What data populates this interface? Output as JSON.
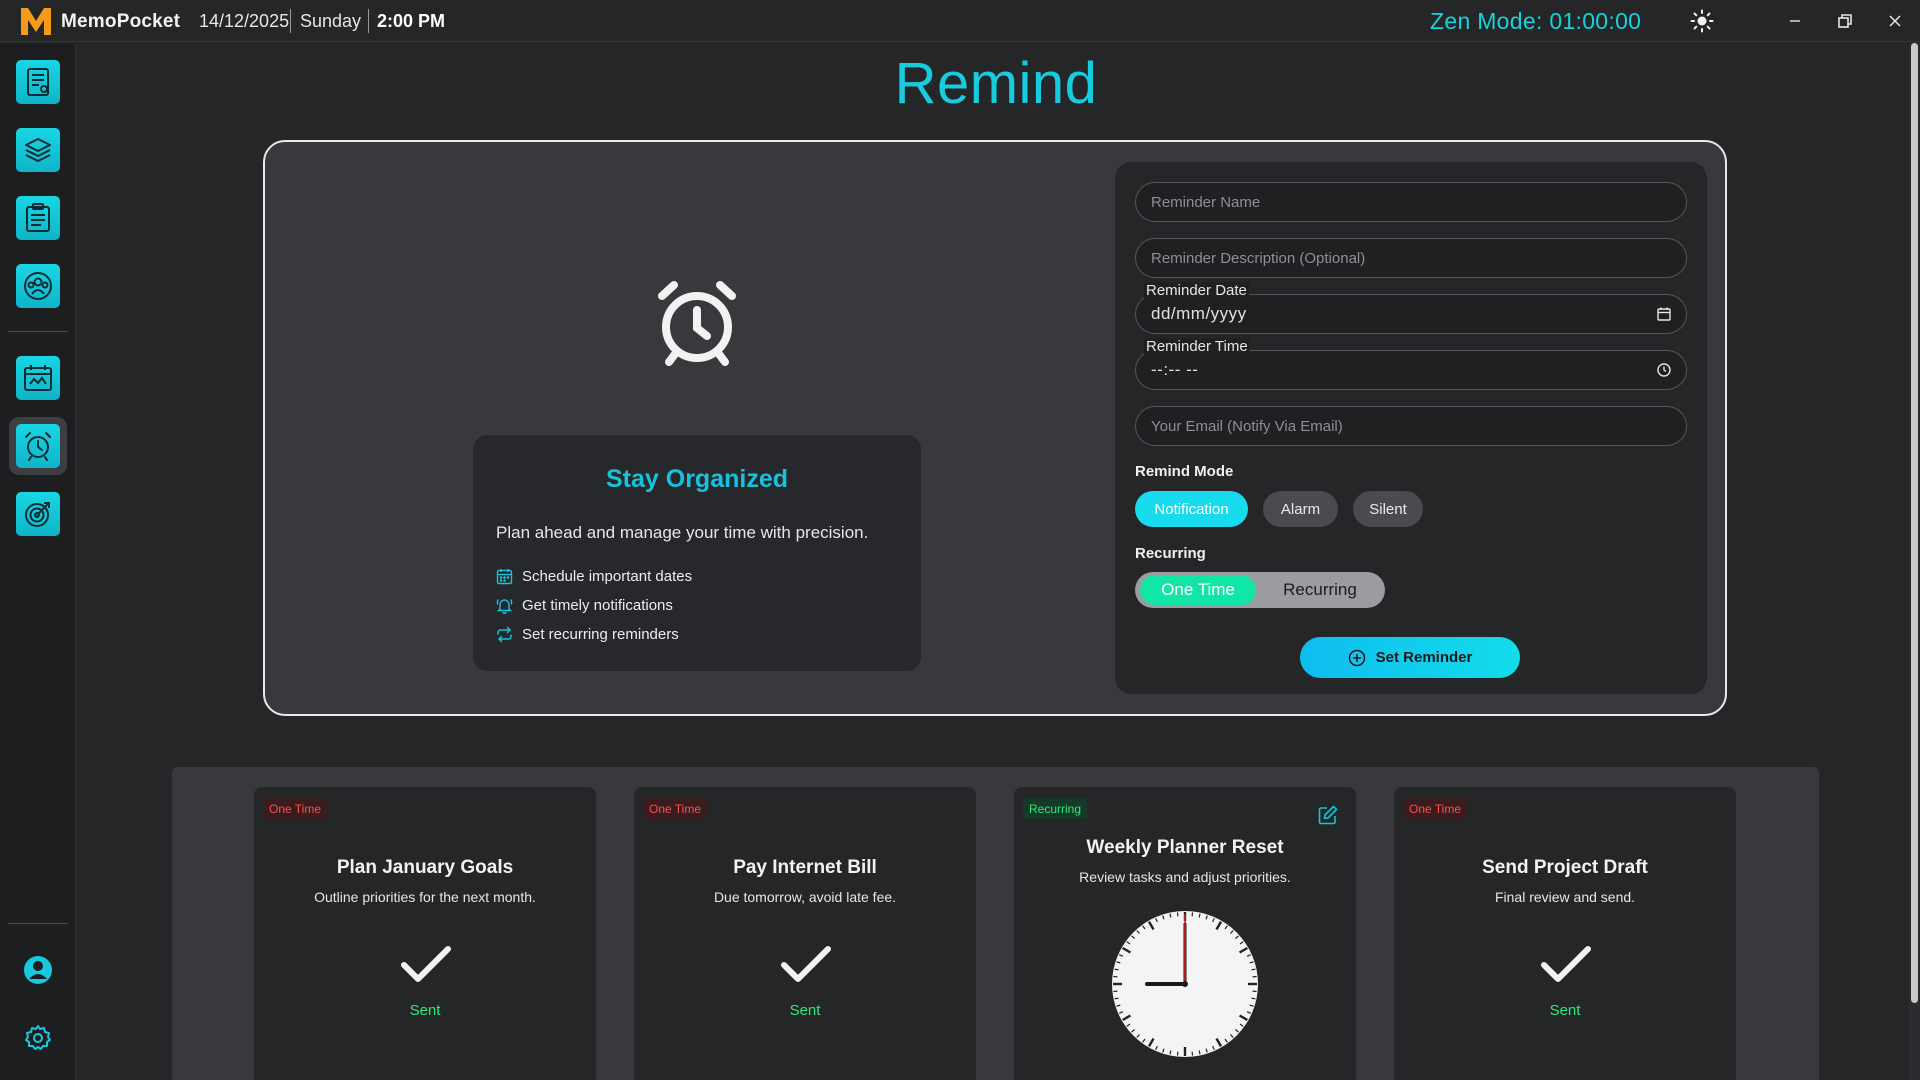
{
  "titlebar": {
    "app_name": "MemoPocket",
    "date": "14/12/2025",
    "day": "Sunday",
    "time": "2:00 PM",
    "zen_mode": "Zen Mode: 01:00:00",
    "icons": {
      "theme": "sun-icon",
      "minimize": "minimize-icon",
      "restore": "restore-icon",
      "close": "close-icon"
    }
  },
  "sidebar": {
    "items": [
      {
        "name": "notes",
        "icon": "notes-document-icon"
      },
      {
        "name": "flashcards",
        "icon": "layers-stack-icon"
      },
      {
        "name": "tasks",
        "icon": "clipboard-list-icon"
      },
      {
        "name": "community",
        "icon": "people-group-icon"
      },
      {
        "name": "calendar",
        "icon": "calendar-icon"
      },
      {
        "name": "remind",
        "icon": "alarm-clock-icon",
        "active": true
      },
      {
        "name": "goals",
        "icon": "target-icon"
      }
    ],
    "bottom": [
      {
        "name": "profile",
        "icon": "user-circle-icon"
      },
      {
        "name": "settings",
        "icon": "gear-icon"
      }
    ]
  },
  "page": {
    "title": "Remind"
  },
  "info": {
    "title": "Stay Organized",
    "text": "Plan ahead and manage your time with precision.",
    "features": [
      {
        "icon": "calendar-icon",
        "label": "Schedule important dates"
      },
      {
        "icon": "bell-icon",
        "label": "Get timely notifications"
      },
      {
        "icon": "repeat-icon",
        "label": "Set recurring reminders"
      }
    ]
  },
  "form": {
    "name_placeholder": "Reminder Name",
    "description_placeholder": "Reminder Description (Optional)",
    "date_label": "Reminder Date",
    "date_value": "dd/mm/yyyy",
    "time_label": "Reminder Time",
    "time_value": "--:-- --",
    "email_placeholder": "Your Email (Notify Via Email)",
    "remind_mode_label": "Remind Mode",
    "modes": [
      "Notification",
      "Alarm",
      "Silent"
    ],
    "selected_mode": "Notification",
    "recurring_label": "Recurring",
    "recurring_options": [
      "One Time",
      "Recurring"
    ],
    "selected_recurring": "One Time",
    "submit_label": "Set Reminder"
  },
  "reminders": [
    {
      "badge": "One Time",
      "title": "Plan January Goals",
      "description": "Outline priorities for the next month.",
      "status": "Sent"
    },
    {
      "badge": "One Time",
      "title": "Pay Internet Bill",
      "description": "Due tomorrow, avoid late fee.",
      "status": "Sent"
    },
    {
      "badge": "Recurring",
      "title": "Weekly Planner Reset",
      "description": "Review tasks and adjust priorities.",
      "status": ""
    },
    {
      "badge": "One Time",
      "title": "Send Project Draft",
      "description": "Final review and send.",
      "status": "Sent"
    }
  ],
  "colors": {
    "accent": "#18ccdf",
    "sent": "#2ee87a",
    "once_badge": "#ff4d4f",
    "recurring_badge": "#2ee87a",
    "background": "#252628"
  }
}
